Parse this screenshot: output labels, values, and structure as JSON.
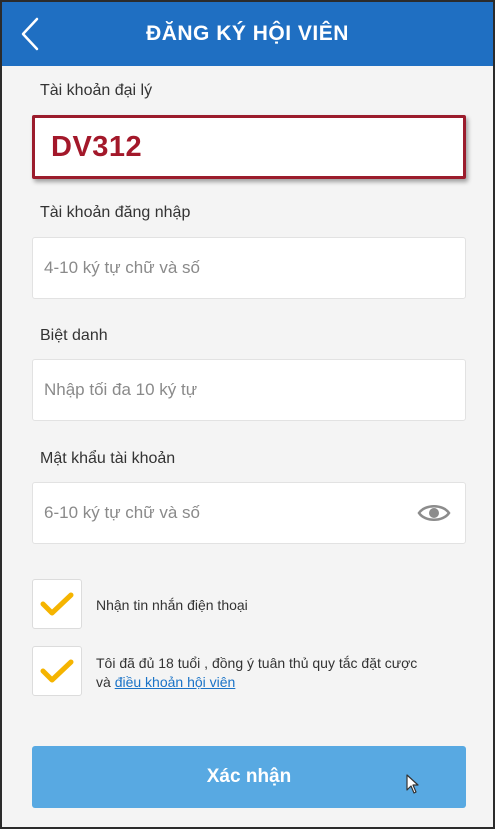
{
  "header": {
    "title": "ĐĂNG KÝ HỘI VIÊN",
    "back_icon": "chevron-left-icon",
    "color": "#1f6fc2"
  },
  "form": {
    "agent_account": {
      "label": "Tài khoản đại lý",
      "value": "DV312",
      "highlight_color": "#9b1c2c"
    },
    "login_account": {
      "label": "Tài khoản đăng nhập",
      "placeholder": "4-10 ký tự chữ và số"
    },
    "nickname": {
      "label": "Biệt danh",
      "placeholder": "Nhập tối đa 10 ký tự"
    },
    "password": {
      "label": "Mật khẩu tài khoản",
      "placeholder": "6-10 ký tự chữ và số",
      "toggle_icon": "eye-icon"
    },
    "sms_opt_in": {
      "checked": true,
      "text": "Nhận tin nhắn điện thoại"
    },
    "age_terms": {
      "checked": true,
      "text": "Tôi đã đủ 18 tuổi , đồng ý tuân thủ quy tắc đặt cược",
      "text_prefix": "và",
      "link_text": "điều khoản hội viên"
    },
    "check_color": "#f5b400"
  },
  "submit": {
    "label": "Xác nhận",
    "color": "#58a9e2"
  }
}
